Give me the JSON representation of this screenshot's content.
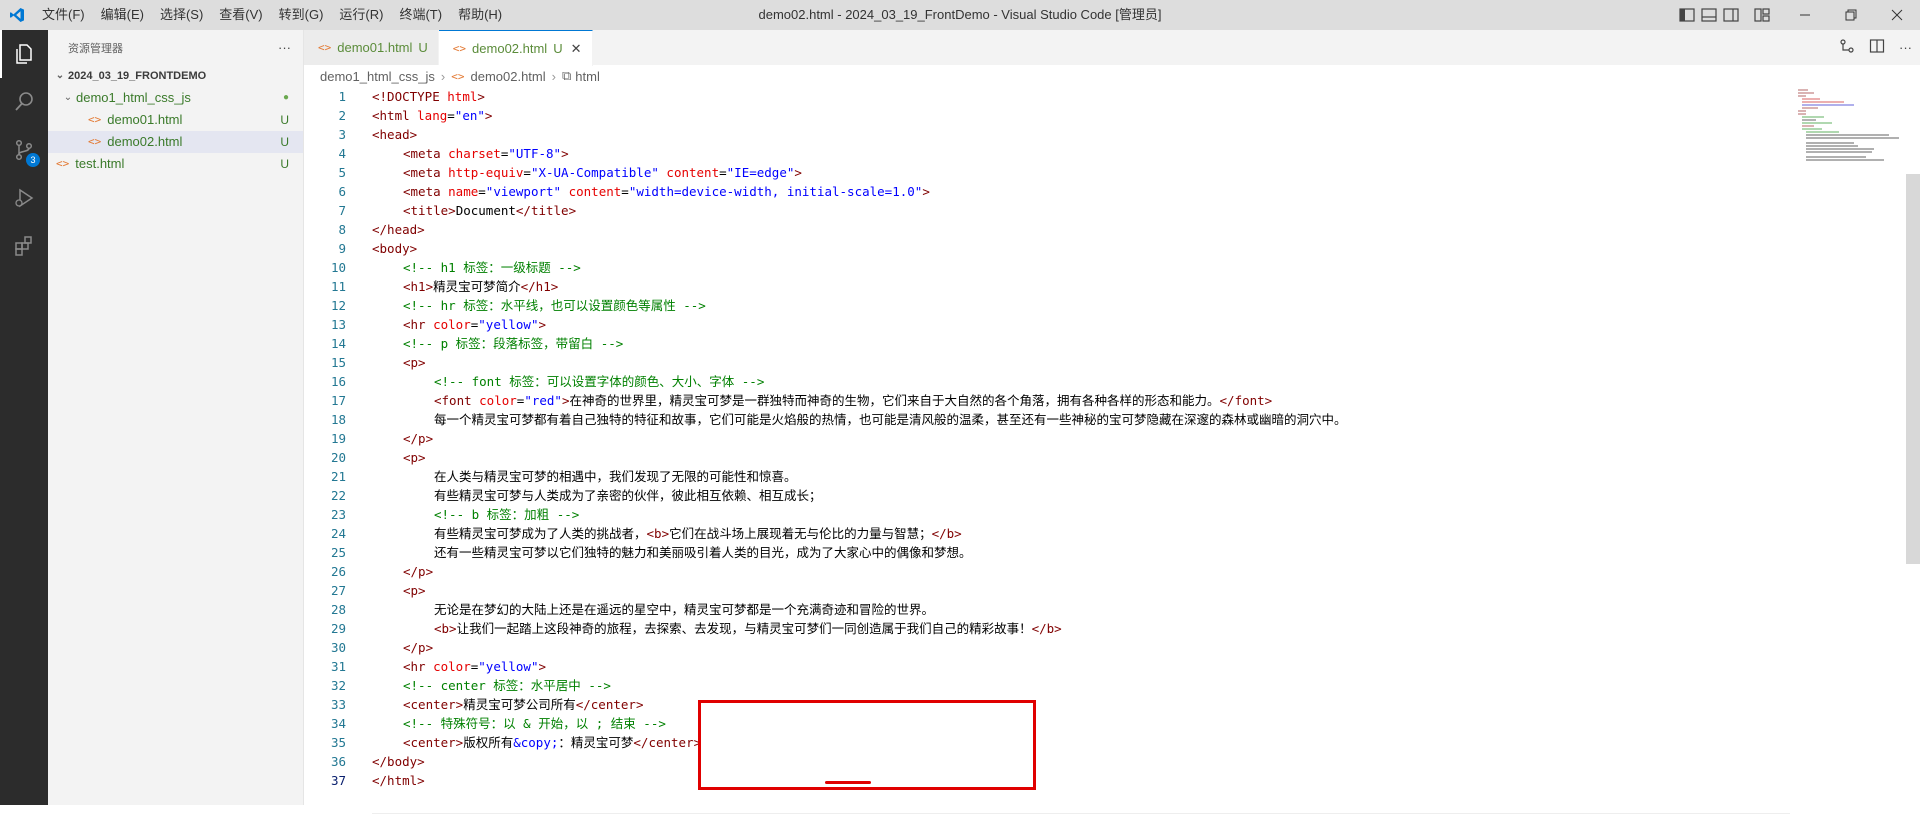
{
  "app": {
    "window_title": "demo02.html - 2024_03_19_FrontDemo - Visual Studio Code [管理员]",
    "menu": [
      "文件(F)",
      "编辑(E)",
      "选择(S)",
      "查看(V)",
      "转到(G)",
      "运行(R)",
      "终端(T)",
      "帮助(H)"
    ]
  },
  "activity": {
    "badge_count": "3"
  },
  "sidebar": {
    "title": "资源管理器",
    "more": "···",
    "workspace": "2024_03_19_FRONTDEMO",
    "folder": "demo1_html_css_js",
    "files": [
      {
        "name": "demo01.html",
        "status": "U"
      },
      {
        "name": "demo02.html",
        "status": "U"
      }
    ],
    "root_files": [
      {
        "name": "test.html",
        "status": "U"
      }
    ]
  },
  "tabs": [
    {
      "label": "demo01.html",
      "status": "U"
    },
    {
      "label": "demo02.html",
      "status": "U",
      "close": "✕"
    }
  ],
  "breadcrumb": [
    "demo1_html_css_js",
    "demo02.html",
    "html"
  ],
  "colors": {
    "tag": "#800000",
    "attr": "#e50000",
    "value": "#0000ff",
    "comment": "#008000",
    "annotation": "#e00000",
    "accent": "#0078d4"
  },
  "code_lines": [
    {
      "n": "1",
      "indent": 0,
      "tokens": [
        {
          "t": "t-tag",
          "s": "<!DOCTYPE "
        },
        {
          "t": "t-attr",
          "s": "html"
        },
        {
          "t": "t-tag",
          "s": ">"
        }
      ]
    },
    {
      "n": "2",
      "indent": 0,
      "tokens": [
        {
          "t": "t-tag",
          "s": "<html "
        },
        {
          "t": "t-attr",
          "s": "lang"
        },
        {
          "t": "t-txt",
          "s": "="
        },
        {
          "t": "t-val",
          "s": "\"en\""
        },
        {
          "t": "t-tag",
          "s": ">"
        }
      ]
    },
    {
      "n": "3",
      "indent": 0,
      "tokens": [
        {
          "t": "t-tag",
          "s": "<head>"
        }
      ]
    },
    {
      "n": "4",
      "indent": 1,
      "tokens": [
        {
          "t": "t-tag",
          "s": "<meta "
        },
        {
          "t": "t-attr",
          "s": "charset"
        },
        {
          "t": "t-txt",
          "s": "="
        },
        {
          "t": "t-val",
          "s": "\"UTF-8\""
        },
        {
          "t": "t-tag",
          "s": ">"
        }
      ]
    },
    {
      "n": "5",
      "indent": 1,
      "tokens": [
        {
          "t": "t-tag",
          "s": "<meta "
        },
        {
          "t": "t-attr",
          "s": "http-equiv"
        },
        {
          "t": "t-txt",
          "s": "="
        },
        {
          "t": "t-val",
          "s": "\"X-UA-Compatible\""
        },
        {
          "t": "t-attr",
          "s": " content"
        },
        {
          "t": "t-txt",
          "s": "="
        },
        {
          "t": "t-val",
          "s": "\"IE=edge\""
        },
        {
          "t": "t-tag",
          "s": ">"
        }
      ]
    },
    {
      "n": "6",
      "indent": 1,
      "tokens": [
        {
          "t": "t-tag",
          "s": "<meta "
        },
        {
          "t": "t-attr",
          "s": "name"
        },
        {
          "t": "t-txt",
          "s": "="
        },
        {
          "t": "t-val",
          "s": "\"viewport\""
        },
        {
          "t": "t-attr",
          "s": " content"
        },
        {
          "t": "t-txt",
          "s": "="
        },
        {
          "t": "t-val",
          "s": "\"width=device-width, initial-scale=1.0\""
        },
        {
          "t": "t-tag",
          "s": ">"
        }
      ]
    },
    {
      "n": "7",
      "indent": 1,
      "tokens": [
        {
          "t": "t-tag",
          "s": "<title>"
        },
        {
          "t": "t-txt",
          "s": "Document"
        },
        {
          "t": "t-tag",
          "s": "</title>"
        }
      ]
    },
    {
      "n": "8",
      "indent": 0,
      "tokens": [
        {
          "t": "t-tag",
          "s": "</head>"
        }
      ]
    },
    {
      "n": "9",
      "indent": 0,
      "tokens": [
        {
          "t": "t-tag",
          "s": "<body>"
        }
      ]
    },
    {
      "n": "10",
      "indent": 1,
      "tokens": [
        {
          "t": "t-cmt",
          "s": "<!-- h1 标签：一级标题 -->"
        }
      ]
    },
    {
      "n": "11",
      "indent": 1,
      "tokens": [
        {
          "t": "t-tag",
          "s": "<h1>"
        },
        {
          "t": "t-txt",
          "s": "精灵宝可梦简介"
        },
        {
          "t": "t-tag",
          "s": "</h1>"
        }
      ]
    },
    {
      "n": "12",
      "indent": 1,
      "tokens": [
        {
          "t": "t-cmt",
          "s": "<!-- hr 标签：水平线，也可以设置颜色等属性 -->"
        }
      ]
    },
    {
      "n": "13",
      "indent": 1,
      "tokens": [
        {
          "t": "t-tag",
          "s": "<hr "
        },
        {
          "t": "t-attr",
          "s": "color"
        },
        {
          "t": "t-txt",
          "s": "="
        },
        {
          "t": "t-val",
          "s": "\"yellow\""
        },
        {
          "t": "t-tag",
          "s": ">"
        }
      ]
    },
    {
      "n": "14",
      "indent": 1,
      "tokens": [
        {
          "t": "t-cmt",
          "s": "<!-- p 标签：段落标签，带留白 -->"
        }
      ]
    },
    {
      "n": "15",
      "indent": 1,
      "tokens": [
        {
          "t": "t-tag",
          "s": "<p>"
        }
      ]
    },
    {
      "n": "16",
      "indent": 2,
      "tokens": [
        {
          "t": "t-cmt",
          "s": "<!-- font 标签：可以设置字体的颜色、大小、字体 -->"
        }
      ]
    },
    {
      "n": "17",
      "indent": 2,
      "tokens": [
        {
          "t": "t-tag",
          "s": "<font "
        },
        {
          "t": "t-attr",
          "s": "color"
        },
        {
          "t": "t-txt",
          "s": "="
        },
        {
          "t": "t-val",
          "s": "\"red\""
        },
        {
          "t": "t-tag",
          "s": ">"
        },
        {
          "t": "t-txt",
          "s": "在神奇的世界里，精灵宝可梦是一群独特而神奇的生物，它们来自于大自然的各个角落，拥有各种各样的形态和能力。"
        },
        {
          "t": "t-tag",
          "s": "</font>"
        }
      ]
    },
    {
      "n": "18",
      "indent": 2,
      "tokens": [
        {
          "t": "t-txt",
          "s": "每一个精灵宝可梦都有着自己独特的特征和故事，它们可能是火焰般的热情，也可能是清风般的温柔，甚至还有一些神秘的宝可梦隐藏在深邃的森林或幽暗的洞穴中。"
        }
      ]
    },
    {
      "n": "19",
      "indent": 1,
      "tokens": [
        {
          "t": "t-tag",
          "s": "</p>"
        }
      ]
    },
    {
      "n": "20",
      "indent": 1,
      "tokens": [
        {
          "t": "t-tag",
          "s": "<p>"
        }
      ]
    },
    {
      "n": "21",
      "indent": 2,
      "tokens": [
        {
          "t": "t-txt",
          "s": "在人类与精灵宝可梦的相遇中，我们发现了无限的可能性和惊喜。"
        }
      ]
    },
    {
      "n": "22",
      "indent": 2,
      "tokens": [
        {
          "t": "t-txt",
          "s": "有些精灵宝可梦与人类成为了亲密的伙伴，彼此相互依赖、相互成长；"
        }
      ]
    },
    {
      "n": "23",
      "indent": 2,
      "tokens": [
        {
          "t": "t-cmt",
          "s": "<!-- b 标签：加粗 -->"
        }
      ]
    },
    {
      "n": "24",
      "indent": 2,
      "tokens": [
        {
          "t": "t-txt",
          "s": "有些精灵宝可梦成为了人类的挑战者，"
        },
        {
          "t": "t-tag",
          "s": "<b>"
        },
        {
          "t": "t-txt",
          "s": "它们在战斗场上展现着无与伦比的力量与智慧；"
        },
        {
          "t": "t-tag",
          "s": "</b>"
        }
      ]
    },
    {
      "n": "25",
      "indent": 2,
      "tokens": [
        {
          "t": "t-txt",
          "s": "还有一些精灵宝可梦以它们独特的魅力和美丽吸引着人类的目光，成为了大家心中的偶像和梦想。"
        }
      ]
    },
    {
      "n": "26",
      "indent": 1,
      "tokens": [
        {
          "t": "t-tag",
          "s": "</p>"
        }
      ]
    },
    {
      "n": "27",
      "indent": 1,
      "tokens": [
        {
          "t": "t-tag",
          "s": "<p>"
        }
      ]
    },
    {
      "n": "28",
      "indent": 2,
      "tokens": [
        {
          "t": "t-txt",
          "s": "无论是在梦幻的大陆上还是在遥远的星空中，精灵宝可梦都是一个充满奇迹和冒险的世界。"
        }
      ]
    },
    {
      "n": "29",
      "indent": 2,
      "tokens": [
        {
          "t": "t-tag",
          "s": "<b>"
        },
        {
          "t": "t-txt",
          "s": "让我们一起踏上这段神奇的旅程，去探索、去发现，与精灵宝可梦们一同创造属于我们自己的精彩故事！"
        },
        {
          "t": "t-tag",
          "s": "</b>"
        }
      ]
    },
    {
      "n": "30",
      "indent": 1,
      "tokens": [
        {
          "t": "t-tag",
          "s": "</p>"
        }
      ]
    },
    {
      "n": "31",
      "indent": 1,
      "tokens": [
        {
          "t": "t-tag",
          "s": "<hr "
        },
        {
          "t": "t-attr",
          "s": "color"
        },
        {
          "t": "t-txt",
          "s": "="
        },
        {
          "t": "t-val",
          "s": "\"yellow\""
        },
        {
          "t": "t-tag",
          "s": ">"
        }
      ]
    },
    {
      "n": "32",
      "indent": 1,
      "tokens": [
        {
          "t": "t-cmt",
          "s": "<!-- center 标签：水平居中 -->"
        }
      ]
    },
    {
      "n": "33",
      "indent": 1,
      "tokens": [
        {
          "t": "t-tag",
          "s": "<center>"
        },
        {
          "t": "t-txt",
          "s": "精灵宝可梦公司所有"
        },
        {
          "t": "t-tag",
          "s": "</center>"
        }
      ]
    },
    {
      "n": "34",
      "indent": 1,
      "tokens": [
        {
          "t": "t-cmt",
          "s": "<!-- 特殊符号：以 & 开始，以 ; 结束 -->"
        }
      ]
    },
    {
      "n": "35",
      "indent": 1,
      "tokens": [
        {
          "t": "t-tag",
          "s": "<center>"
        },
        {
          "t": "t-txt",
          "s": "版权所有"
        },
        {
          "t": "t-ent",
          "s": "&copy;"
        },
        {
          "t": "t-txt",
          "s": "：精灵宝可梦"
        },
        {
          "t": "t-tag",
          "s": "</center>"
        }
      ]
    },
    {
      "n": "36",
      "indent": 0,
      "tokens": [
        {
          "t": "t-tag",
          "s": "</body>"
        }
      ]
    },
    {
      "n": "37",
      "indent": 0,
      "tokens": [
        {
          "t": "t-tag",
          "s": "</html>"
        }
      ]
    }
  ]
}
